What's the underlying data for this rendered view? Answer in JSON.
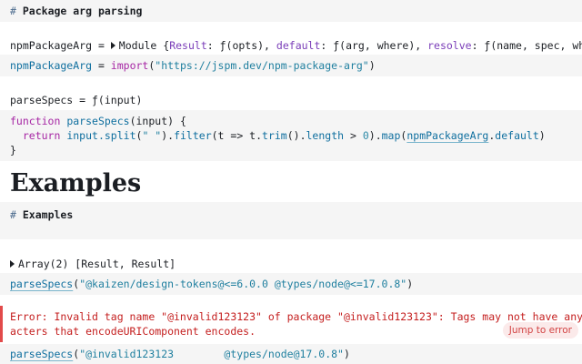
{
  "cells": {
    "md1": {
      "hash": "#",
      "title": "Package arg parsing"
    },
    "out1": {
      "name": "npmPackageArg",
      "eq": " = ",
      "module": "Module",
      "brace_open": " {",
      "k1": "Result",
      "v1": ": ƒ(opts), ",
      "k2": "default",
      "v2": ": ƒ(arg, where), ",
      "k3": "resolve",
      "v3": ": ƒ(name, spec, where,"
    },
    "src1": {
      "name": "npmPackageArg",
      "eq": " = ",
      "kw": "import",
      "open": "(",
      "url": "\"https://jspm.dev/npm-package-arg\"",
      "close": ")"
    },
    "out2": {
      "text": "parseSpecs = ƒ(input)"
    },
    "src2": {
      "line1_kw": "function",
      "line1_fn": "parseSpecs",
      "line1_rest": "(input) {",
      "line2_kw": "return",
      "line2_a": " input.",
      "line2_split": "split",
      "line2_b": "(",
      "line2_str": "\" \"",
      "line2_c": ").",
      "line2_filter": "filter",
      "line2_d": "(t => t.",
      "line2_trim": "trim",
      "line2_e": "().",
      "line2_len": "length",
      "line2_f": " > ",
      "line2_zero": "0",
      "line2_g": ").",
      "line2_map": "map",
      "line2_h": "(",
      "line2_npa": "npmPackageArg",
      "line2_i": ".",
      "line2_default": "default",
      "line2_j": ")",
      "line3": "}"
    },
    "heading": "Examples",
    "md2": {
      "hash": "#",
      "title": "Examples"
    },
    "out3": {
      "text": "Array(2) [Result, Result]"
    },
    "src3": {
      "fn": "parseSpecs",
      "open": "(",
      "arg": "\"@kaizen/design-tokens@<=6.0.0 @types/node@<=17.0.8\"",
      "close": ")"
    },
    "error": {
      "line1": "Error: Invalid tag name \"@invalid123123\" of package \"@invalid123123\": Tags may not have any char",
      "line2": "acters that encodeURIComponent encodes.",
      "jump": "Jump to error"
    },
    "src4": {
      "fn": "parseSpecs",
      "open": "(",
      "arg": "\"@invalid123123        @types/node@17.0.8\"",
      "close": ")"
    }
  },
  "colors": {
    "error": "#c41e1e",
    "error_bar": "#e24a4a",
    "cell_bg": "#f5f5f5"
  }
}
